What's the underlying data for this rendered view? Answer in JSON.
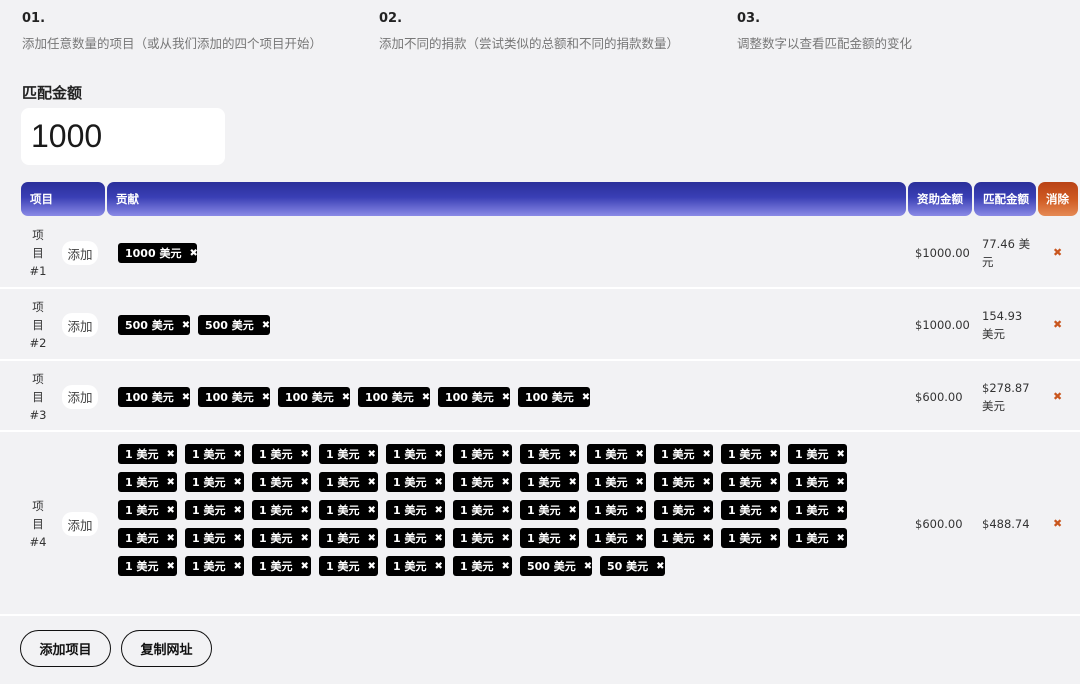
{
  "steps": [
    {
      "num": "01.",
      "text": "添加任意数量的项目（或从我们添加的四个项目开始）"
    },
    {
      "num": "02.",
      "text": "添加不同的捐款（尝试类似的总额和不同的捐款数量）"
    },
    {
      "num": "03.",
      "text": "调整数字以查看匹配金额的变化"
    }
  ],
  "match": {
    "label": "匹配金额",
    "value": "1000"
  },
  "table_headers": {
    "project": "项目",
    "contribution": "贡献",
    "funding": "资助金额",
    "match": "匹配金额",
    "clear": "消除"
  },
  "add_label": "添加",
  "delete_symbol": "✖",
  "chip_delete_symbol": "✖",
  "rows": [
    {
      "project": "项目#1",
      "contributions": [
        "1000 美元"
      ],
      "funding": "$1000.00",
      "match": "77.46 美元"
    },
    {
      "project": "项目#2",
      "contributions": [
        "500 美元",
        "500 美元"
      ],
      "funding": "$1000.00",
      "match": "154.93 美元"
    },
    {
      "project": "项目#3",
      "contributions": [
        "100 美元",
        "100 美元",
        "100 美元",
        "100 美元",
        "100 美元",
        "100 美元"
      ],
      "funding": "$600.00",
      "match": "$278.87 美元"
    },
    {
      "project": "项目#4",
      "contributions": [
        "1 美元",
        "1 美元",
        "1 美元",
        "1 美元",
        "1 美元",
        "1 美元",
        "1 美元",
        "1 美元",
        "1 美元",
        "1 美元",
        "1 美元",
        "1 美元",
        "1 美元",
        "1 美元",
        "1 美元",
        "1 美元",
        "1 美元",
        "1 美元",
        "1 美元",
        "1 美元",
        "1 美元",
        "1 美元",
        "1 美元",
        "1 美元",
        "1 美元",
        "1 美元",
        "1 美元",
        "1 美元",
        "1 美元",
        "1 美元",
        "1 美元",
        "1 美元",
        "1 美元",
        "1 美元",
        "1 美元",
        "1 美元",
        "1 美元",
        "1 美元",
        "1 美元",
        "1 美元",
        "1 美元",
        "1 美元",
        "1 美元",
        "1 美元",
        "1 美元",
        "1 美元",
        "1 美元",
        "1 美元",
        "1 美元",
        "1 美元",
        "500 美元",
        "50 美元"
      ],
      "funding": "$600.00",
      "match": "$488.74"
    }
  ],
  "buttons": {
    "add_project": "添加项目",
    "copy_url": "复制网址"
  }
}
